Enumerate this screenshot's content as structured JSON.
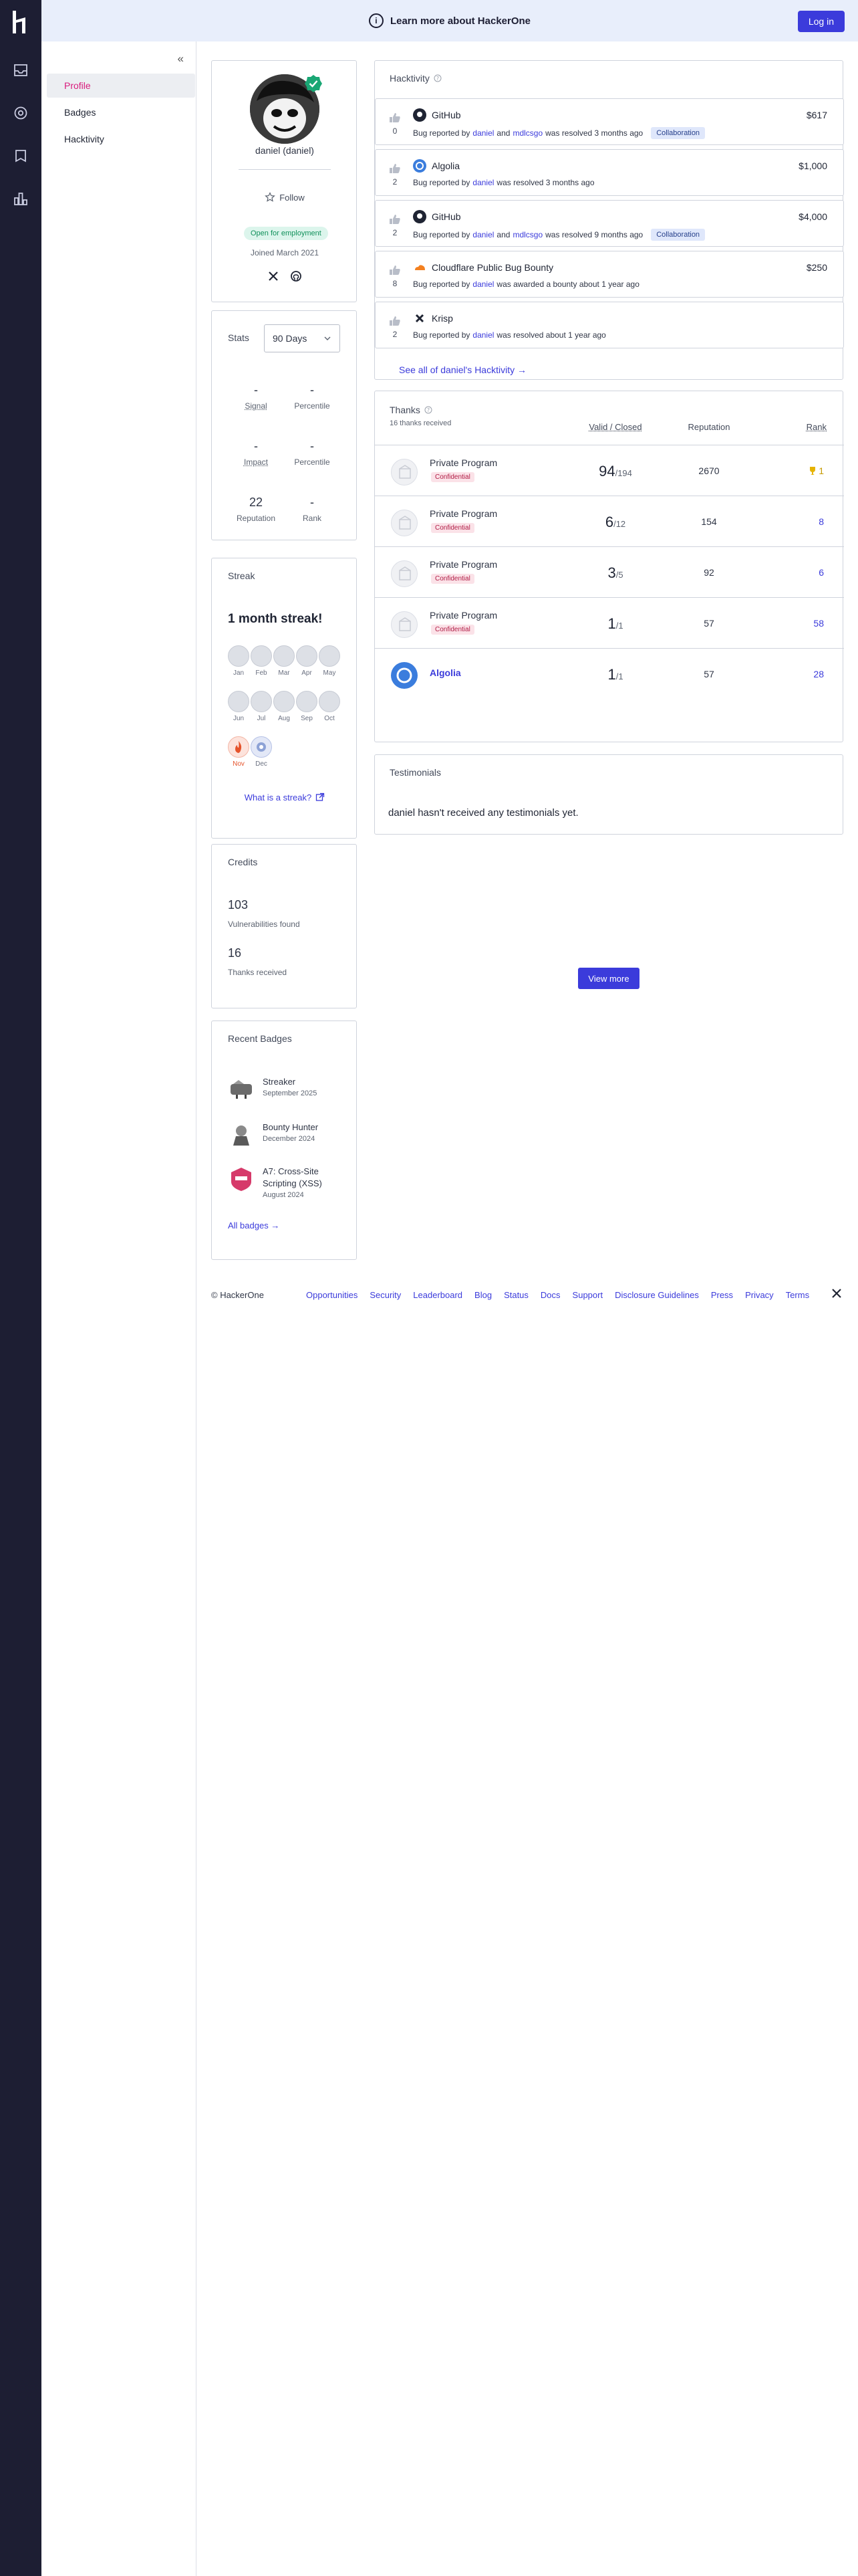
{
  "banner": {
    "text": "Learn more about HackerOne",
    "login_label": "Log in"
  },
  "sidebar": {
    "items": [
      {
        "label": "Profile",
        "active": true
      },
      {
        "label": "Badges",
        "active": false
      },
      {
        "label": "Hacktivity",
        "active": false
      }
    ]
  },
  "profile": {
    "name": "daniel (daniel)",
    "follow_label": "Follow",
    "employment_badge": "Open for employment",
    "joined": "Joined March 2021"
  },
  "stats": {
    "title": "Stats",
    "period": "90 Days",
    "items": [
      {
        "value": "-",
        "label": "Signal"
      },
      {
        "value": "-",
        "label": "Percentile"
      },
      {
        "value": "-",
        "label": "Impact"
      },
      {
        "value": "-",
        "label": "Percentile"
      },
      {
        "value": "22",
        "label": "Reputation"
      },
      {
        "value": "-",
        "label": "Rank"
      }
    ]
  },
  "streak": {
    "title": "Streak",
    "headline": "1 month streak!",
    "months": [
      "Jan",
      "Feb",
      "Mar",
      "Apr",
      "May",
      "Jun",
      "Jul",
      "Aug",
      "Sep",
      "Oct",
      "Nov",
      "Dec"
    ],
    "link": "What is a streak?"
  },
  "credits": {
    "title": "Credits",
    "vulns": "103",
    "vulns_label": "Vulnerabilities found",
    "thanks": "16",
    "thanks_label": "Thanks received"
  },
  "badges": {
    "title": "Recent Badges",
    "items": [
      {
        "name": "Streaker",
        "date": "September 2025"
      },
      {
        "name": "Bounty Hunter",
        "date": "December 2024"
      },
      {
        "name": "A7: Cross-Site Scripting (XSS)",
        "date": "August 2024"
      }
    ],
    "all_link": "All badges"
  },
  "hacktivity": {
    "title": "Hacktivity",
    "items": [
      {
        "votes": "0",
        "program": "GitHub",
        "amount": "$617",
        "prefix": "Bug reported by",
        "user1": "daniel",
        "and": "and",
        "user2": "mdlcsgo",
        "status": "was resolved 3 months ago",
        "tag": "Collaboration"
      },
      {
        "votes": "2",
        "program": "Algolia",
        "amount": "$1,000",
        "prefix": "Bug reported by",
        "user1": "daniel",
        "status": "was resolved 3 months ago"
      },
      {
        "votes": "2",
        "program": "GitHub",
        "amount": "$4,000",
        "prefix": "Bug reported by",
        "user1": "daniel",
        "and": "and",
        "user2": "mdlcsgo",
        "status": "was resolved 9 months ago",
        "tag": "Collaboration"
      },
      {
        "votes": "8",
        "program": "Cloudflare Public Bug Bounty",
        "amount": "$250",
        "prefix": "Bug reported by",
        "user1": "daniel",
        "status": "was awarded a bounty about 1 year ago"
      },
      {
        "votes": "2",
        "program": "Krisp",
        "amount": "",
        "prefix": "Bug reported by",
        "user1": "daniel",
        "status": "was resolved about 1 year ago"
      }
    ],
    "see_all": "See all of daniel's Hacktivity"
  },
  "thanks": {
    "title": "Thanks",
    "subtitle": "16 thanks received",
    "col_valid": "Valid / Closed",
    "col_rep": "Reputation",
    "col_rank": "Rank",
    "rows": [
      {
        "name": "Private Program",
        "conf": "Confidential",
        "valid": "94",
        "closed": "/194",
        "rep": "2670",
        "rank": "1"
      },
      {
        "name": "Private Program",
        "conf": "Confidential",
        "valid": "6",
        "closed": "/12",
        "rep": "154",
        "rank": "8"
      },
      {
        "name": "Private Program",
        "conf": "Confidential",
        "valid": "3",
        "closed": "/5",
        "rep": "92",
        "rank": "6"
      },
      {
        "name": "Private Program",
        "conf": "Confidential",
        "valid": "1",
        "closed": "/1",
        "rep": "57",
        "rank": "58"
      },
      {
        "name": "Algolia",
        "conf": "",
        "valid": "1",
        "closed": "/1",
        "rep": "57",
        "rank": "28"
      }
    ],
    "view_more": "View more"
  },
  "testimonials": {
    "title": "Testimonials",
    "empty": "daniel hasn't received any testimonials yet."
  },
  "footer": {
    "copy": "© HackerOne",
    "links": [
      "Opportunities",
      "Security",
      "Leaderboard",
      "Blog",
      "Status",
      "Docs",
      "Support",
      "Disclosure Guidelines",
      "Press",
      "Privacy",
      "Terms"
    ]
  },
  "colors": {
    "accent": "#3b3bdb",
    "rail": "#1d1e33",
    "active_nav": "#d91c7d"
  }
}
